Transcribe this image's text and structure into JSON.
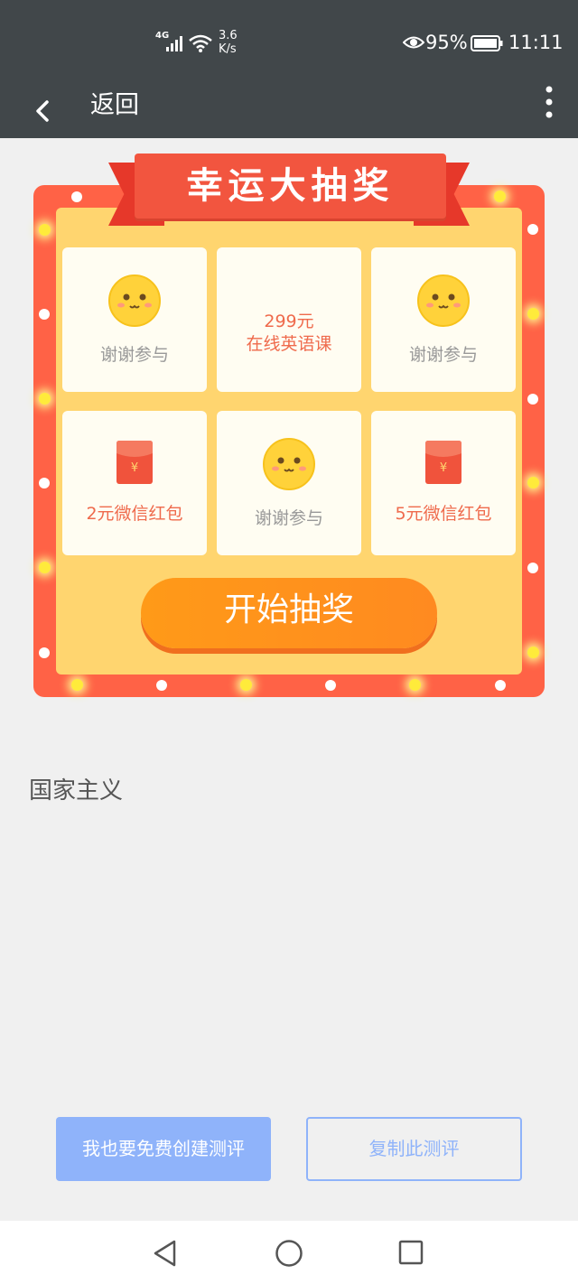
{
  "status_bar": {
    "network": "4G",
    "speed": "3.6",
    "speed_unit": "K/s",
    "battery": "95%",
    "time": "11:11"
  },
  "app_bar": {
    "back_label": "返回"
  },
  "lottery": {
    "title": "幸运大抽奖",
    "prizes": [
      {
        "label": "谢谢参与",
        "icon": "smiley-face-icon"
      },
      {
        "label_line1": "299元",
        "label_line2": "在线英语课"
      },
      {
        "label": "谢谢参与",
        "icon": "smiley-face-icon"
      },
      {
        "label": "2元微信红包",
        "icon": "red-envelope-icon"
      },
      {
        "label": "谢谢参与",
        "icon": "smiley-face-icon"
      },
      {
        "label": "5元微信红包",
        "icon": "red-envelope-icon"
      }
    ],
    "start_button": "开始抽奖"
  },
  "content": {
    "text": "国家主义"
  },
  "actions": {
    "create_label": "我也要免费创建测评",
    "copy_label": "复制此测评"
  },
  "colors": {
    "bar": "#41474a",
    "board": "#ff6246",
    "board_inner": "#ffd56f",
    "accent_blue": "#8fb3fa",
    "prize_red": "#ef6a4c"
  }
}
